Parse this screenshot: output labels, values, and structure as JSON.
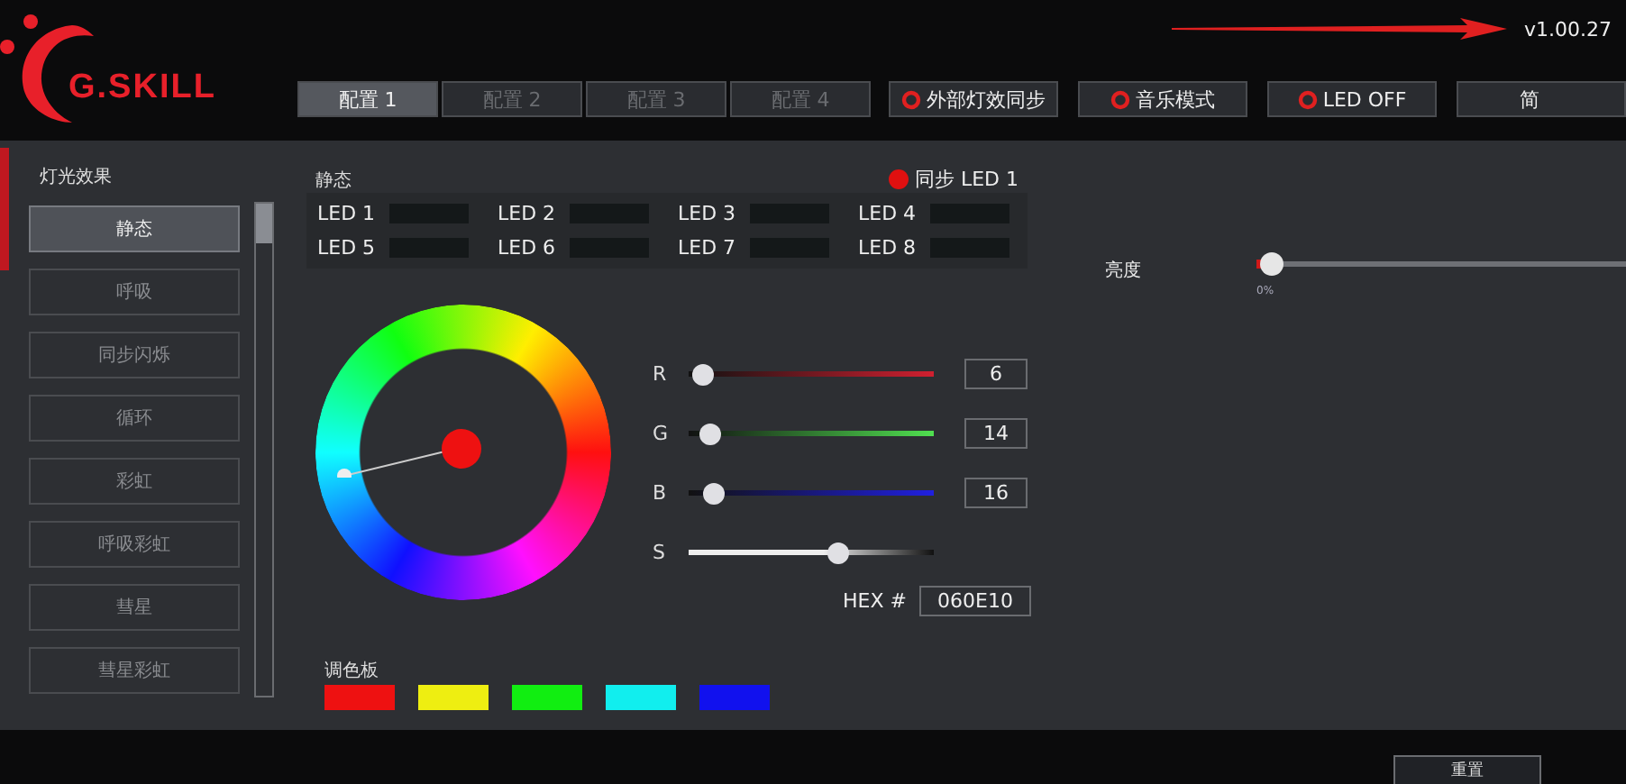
{
  "header": {
    "logo": "G.SKILL",
    "version": "v1.00.27"
  },
  "profiles": [
    {
      "label": "配置 1",
      "selected": true
    },
    {
      "label": "配置 2",
      "selected": false
    },
    {
      "label": "配置 3",
      "selected": false
    },
    {
      "label": "配置 4",
      "selected": false
    }
  ],
  "header_buttons": [
    {
      "label": "外部灯效同步",
      "ring": true
    },
    {
      "label": "音乐模式",
      "ring": true
    },
    {
      "label": "LED OFF",
      "ring": true
    },
    {
      "label": "简",
      "ring": false
    }
  ],
  "effects": {
    "title": "灯光效果",
    "items": [
      {
        "label": "静态",
        "selected": true
      },
      {
        "label": "呼吸",
        "selected": false
      },
      {
        "label": "同步闪烁",
        "selected": false
      },
      {
        "label": "循环",
        "selected": false
      },
      {
        "label": "彩虹",
        "selected": false
      },
      {
        "label": "呼吸彩虹",
        "selected": false
      },
      {
        "label": "彗星",
        "selected": false
      },
      {
        "label": "彗星彩虹",
        "selected": false
      }
    ]
  },
  "panel": {
    "title": "静态",
    "leds": [
      "LED 1",
      "LED 2",
      "LED 3",
      "LED 4",
      "LED 5",
      "LED 6",
      "LED 7",
      "LED 8"
    ],
    "sync": {
      "label": "同步 LED 1",
      "on": true
    }
  },
  "brightness": {
    "label": "亮度",
    "level": 0,
    "reading": "0%"
  },
  "channels": [
    {
      "kind": "red",
      "name": "R",
      "level": 0.06,
      "value": "6"
    },
    {
      "kind": "green",
      "name": "G",
      "level": 0.09,
      "value": "14"
    },
    {
      "kind": "blue",
      "name": "B",
      "level": 0.1,
      "value": "16"
    },
    {
      "kind": "saturation",
      "name": "S",
      "level": 0.61
    }
  ],
  "hex": {
    "label": "HEX #",
    "value": "060E10"
  },
  "palette": {
    "title": "调色板",
    "swatches": [
      {
        "color": "#ee1111"
      },
      {
        "color": "#eeee11"
      },
      {
        "color": "#11ee11"
      },
      {
        "color": "#11eeee"
      },
      {
        "color": "#1111ee"
      }
    ]
  },
  "footer": {
    "buttons": [
      "重置"
    ]
  }
}
